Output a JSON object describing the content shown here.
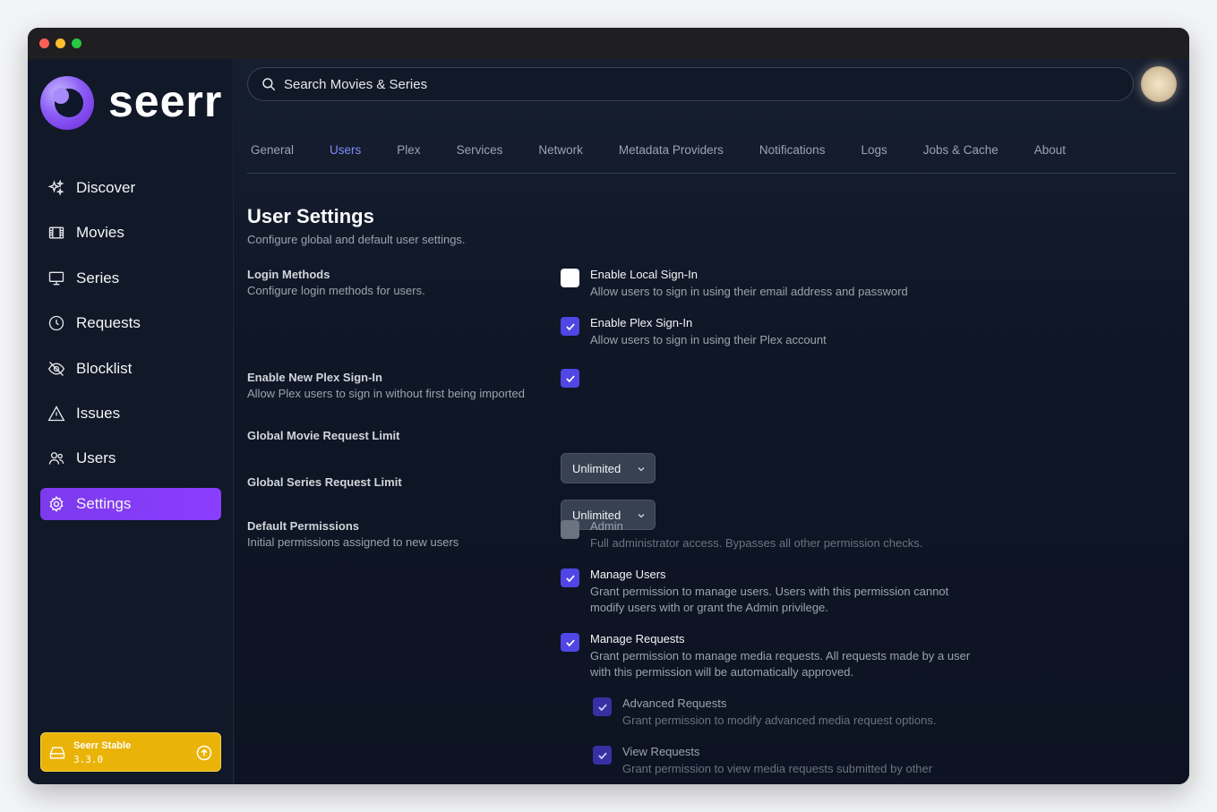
{
  "app": {
    "logo_text": "seerr"
  },
  "search": {
    "placeholder": "Search Movies & Series"
  },
  "sidebar": {
    "items": [
      {
        "label": "Discover",
        "icon": "sparkles-icon"
      },
      {
        "label": "Movies",
        "icon": "film-icon"
      },
      {
        "label": "Series",
        "icon": "tv-icon"
      },
      {
        "label": "Requests",
        "icon": "clock-icon"
      },
      {
        "label": "Blocklist",
        "icon": "eye-slash-icon"
      },
      {
        "label": "Issues",
        "icon": "warning-icon"
      },
      {
        "label": "Users",
        "icon": "users-icon"
      },
      {
        "label": "Settings",
        "icon": "gear-icon",
        "active": true
      }
    ],
    "version": {
      "name": "Seerr Stable",
      "number": "3.3.0"
    }
  },
  "tabs": [
    "General",
    "Users",
    "Plex",
    "Services",
    "Network",
    "Metadata Providers",
    "Notifications",
    "Logs",
    "Jobs & Cache",
    "About"
  ],
  "active_tab": "Users",
  "page": {
    "title": "User Settings",
    "subtitle": "Configure global and default user settings."
  },
  "login_methods": {
    "title": "Login Methods",
    "desc": "Configure login methods for users.",
    "local": {
      "title": "Enable Local Sign-In",
      "desc": "Allow users to sign in using their email address and password",
      "checked": false
    },
    "plex": {
      "title": "Enable Plex Sign-In",
      "desc": "Allow users to sign in using their Plex account",
      "checked": true
    }
  },
  "new_plex": {
    "title": "Enable New Plex Sign-In",
    "desc": "Allow Plex users to sign in without first being imported",
    "checked": true
  },
  "movie_limit": {
    "title": "Global Movie Request Limit",
    "value": "Unlimited"
  },
  "series_limit": {
    "title": "Global Series Request Limit",
    "value": "Unlimited"
  },
  "permissions": {
    "title": "Default Permissions",
    "desc": "Initial permissions assigned to new users",
    "admin": {
      "title": "Admin",
      "desc": "Full administrator access. Bypasses all other permission checks.",
      "checked": false
    },
    "manage_users": {
      "title": "Manage Users",
      "desc": "Grant permission to manage users. Users with this permission cannot modify users with or grant the Admin privilege.",
      "checked": true
    },
    "manage_requests": {
      "title": "Manage Requests",
      "desc": "Grant permission to manage media requests. All requests made by a user with this permission will be automatically approved.",
      "checked": true
    },
    "advanced_requests": {
      "title": "Advanced Requests",
      "desc": "Grant permission to modify advanced media request options.",
      "checked": true
    },
    "view_requests": {
      "title": "View Requests",
      "desc": "Grant permission to view media requests submitted by other",
      "checked": true
    }
  }
}
